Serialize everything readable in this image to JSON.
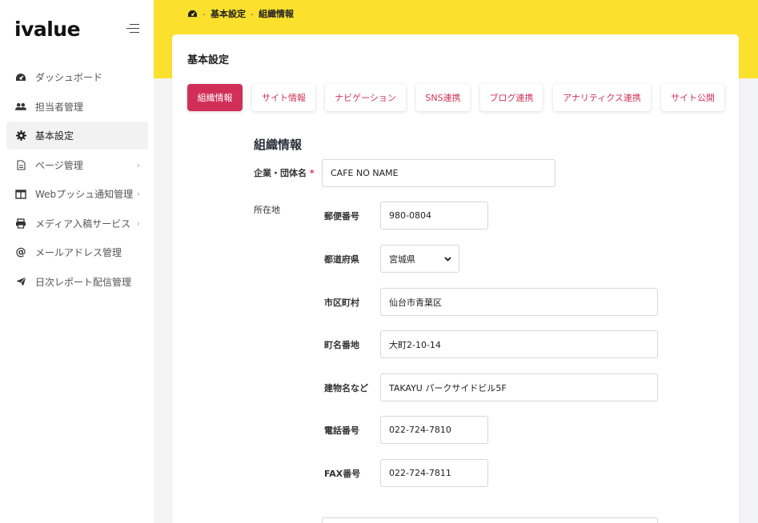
{
  "app": {
    "logo": "ivalue"
  },
  "sidebar": {
    "items": [
      {
        "label": "ダッシュボード"
      },
      {
        "label": "担当者管理"
      },
      {
        "label": "基本設定"
      },
      {
        "label": "ページ管理"
      },
      {
        "label": "Webプッシュ通知管理"
      },
      {
        "label": "メディア入稿サービス"
      },
      {
        "label": "メールアドレス管理"
      },
      {
        "label": "日次レポート配信管理"
      }
    ]
  },
  "breadcrumb": {
    "level1": "基本設定",
    "level2": "組織情報"
  },
  "card": {
    "title": "基本設定"
  },
  "tabs": [
    {
      "label": "組織情報"
    },
    {
      "label": "サイト情報"
    },
    {
      "label": "ナビゲーション"
    },
    {
      "label": "SNS連携"
    },
    {
      "label": "ブログ連携"
    },
    {
      "label": "アナリティクス連携"
    },
    {
      "label": "サイト公開"
    }
  ],
  "form": {
    "section_title": "組織情報",
    "company_label": "企業・団体名",
    "required_mark": "*",
    "company_value": "CAFE NO NAME",
    "address_label": "所在地",
    "postal_label": "郵便番号",
    "postal_value": "980-0804",
    "prefecture_label": "都道府県",
    "prefecture_value": "宮城県",
    "city_label": "市区町村",
    "city_value": "仙台市青葉区",
    "street_label": "町名番地",
    "street_value": "大町2-10-14",
    "building_label": "建物名など",
    "building_value": "TAKAYU パークサイドビル5F",
    "phone_label": "電話番号",
    "phone_value": "022-724-7810",
    "fax_label": "FAX番号",
    "fax_value": "022-724-7811"
  },
  "colors": {
    "accent": "#d12f58",
    "header_yellow": "#fbe12e"
  }
}
